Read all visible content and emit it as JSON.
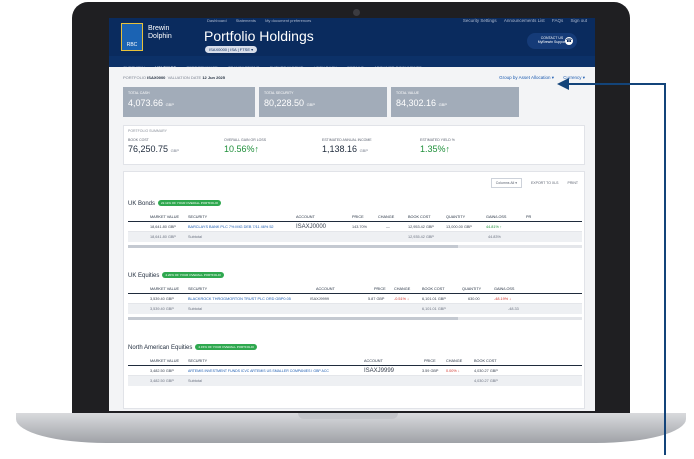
{
  "header": {
    "brand": "Brewin Dolphin",
    "logo_text": "RBC",
    "title": "Portfolio Holdings",
    "account_pill": "ISAX0000 | ISA | FTSE ▾",
    "top_links": [
      "Dashboard",
      "Statements",
      "My document preferences"
    ],
    "right_links": [
      "Security Settings",
      "Announcements List",
      "FAQs",
      "Sign out"
    ],
    "contact_label": "CONTACT US",
    "contact_sub": "MyBrewin Support"
  },
  "nav": [
    "OVERVIEW",
    "HOLDINGS",
    "PERFORMANCE",
    "TRANSACTIONS",
    "FUTURE INCOME",
    "LOOK BACK",
    "DETAILS",
    "ARCHIVED DOCUMENTS"
  ],
  "subheader": {
    "portfolio_label": "PORTFOLIO",
    "portfolio_value": "ISAX0000",
    "valuation_label": "VALUATION DATE",
    "valuation_value": "12 Jun 2025",
    "group_by": "Group by Asset Allocation ▾",
    "currency": "Currency ▾"
  },
  "cards": [
    {
      "label": "TOTAL CASH",
      "value": "4,073.66",
      "unit": "GBP"
    },
    {
      "label": "TOTAL SECURITY",
      "value": "80,228.50",
      "unit": "GBP"
    },
    {
      "label": "TOTAL VALUE",
      "value": "84,302.16",
      "unit": "GBP"
    }
  ],
  "summary": {
    "title": "PORTFOLIO SUMMARY",
    "items": [
      {
        "label": "BOOK COST",
        "value": "76,250.75",
        "unit": "GBP"
      },
      {
        "label": "OVERALL GAIN OR LOSS",
        "value": "10.56%↑",
        "unit": ""
      },
      {
        "label": "ESTIMATED ANNUAL INCOME",
        "value": "1,138.16",
        "unit": "GBP"
      },
      {
        "label": "ESTIMATED YIELD %",
        "value": "1.35%↑",
        "unit": ""
      }
    ]
  },
  "tools": {
    "columns": "Columns All ▾",
    "export": "EXPORT TO XLS",
    "print": "PRINT"
  },
  "groups": [
    {
      "name": "UK Bonds",
      "badge": "22.11% OF YOUR OVERALL PORTFOLIO",
      "headers": [
        "MARKET VALUE",
        "SECURITY",
        "ACCOUNT",
        "PRICE",
        "CHANGE",
        "BOOK COST",
        "QUANTITY",
        "GAIN/LOSS",
        "PR"
      ],
      "row": [
        "18,641.80 GBP",
        "BARCLAYS BANK PLC 7% MIG DEB 7/11 46% 52",
        "ISAXJ0000",
        "143.70%",
        "—",
        "12,953.42 GBP",
        "13,000.00 GBP",
        "44.81% ↑",
        ""
      ],
      "subtotal": [
        "18,641.80 GBP",
        "Subtotal",
        "12,935.42 GBP",
        "44.83%"
      ]
    },
    {
      "name": "UK Equities",
      "badge": "4.20% OF YOUR OVERALL PORTFOLIO",
      "headers": [
        "MARKET VALUE",
        "SECURITY",
        "ACCOUNT",
        "PRICE",
        "CHANGE",
        "BOOK COST",
        "QUANTITY",
        "GAIN/LOSS"
      ],
      "row": [
        "3,539.40 GBP",
        "BLACKROCK THROGMORTON TRUST PLC ORD GBP0.05",
        "ISAXJ9999",
        "5.87 GBP",
        "-0.51% ↓",
        "6,101.01 GBP",
        "630.00",
        "-48.19% ↓"
      ],
      "subtotal": [
        "3,539.40 GBP",
        "Subtotal",
        "6,101.01 GBP",
        "-48.33"
      ]
    },
    {
      "name": "North American Equities",
      "badge": "4.15% OF YOUR OVERALL PORTFOLIO",
      "headers": [
        "MARKET VALUE",
        "SECURITY",
        "ACCOUNT",
        "PRICE",
        "CHANGE",
        "BOOK COST"
      ],
      "row": [
        "3,482.50 GBP",
        "ARTEMIS INVESTMENT FUNDS ICVC ARTEMIS US SMALLER COMPANIES I GBP ACC",
        "ISAXJ9999",
        "3.59 GBP",
        "0.00% ↓",
        "4,030.27 GBP"
      ],
      "subtotal": [
        "3,482.50 GBP",
        "Subtotal",
        "4,030.27 GBP"
      ]
    }
  ],
  "colors": {
    "brand_navy": "#0a2b5e",
    "card_grey": "#a2acb9",
    "gain_green": "#1f8f3a",
    "loss_red": "#d0342c",
    "annotation": "#13447a"
  }
}
